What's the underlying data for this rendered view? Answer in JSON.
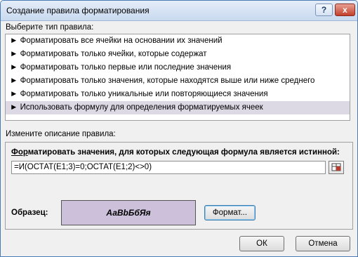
{
  "window": {
    "title": "Создание правила форматирования"
  },
  "select_type_label": "Выберите тип правила:",
  "rule_types": [
    "► Форматировать все ячейки на основании их значений",
    "► Форматировать только ячейки, которые содержат",
    "► Форматировать только первые или последние значения",
    "► Форматировать только значения, которые находятся выше или ниже среднего",
    "► Форматировать только уникальные или повторяющиеся значения",
    "► Использовать формулу для определения форматируемых ячеек"
  ],
  "edit_desc_label": "Измените описание правила:",
  "formula_prompt_underlined": "Фор",
  "formula_prompt_rest": "матировать значения, для которых следующая формула является истинной:",
  "formula_value": "=И(ОСТАТ(E1;3)=0;ОСТАТ(E1;2)<>0)",
  "sample_label": "Образец:",
  "sample_text": "АаВbБбЯя",
  "format_button": "Формат...",
  "ok_button": "ОК",
  "cancel_button": "Отмена",
  "icons": {
    "help": "?",
    "close": "x"
  },
  "colors": {
    "preview_bg": "#cdc0db",
    "selected_row": "#dcd8e4"
  }
}
